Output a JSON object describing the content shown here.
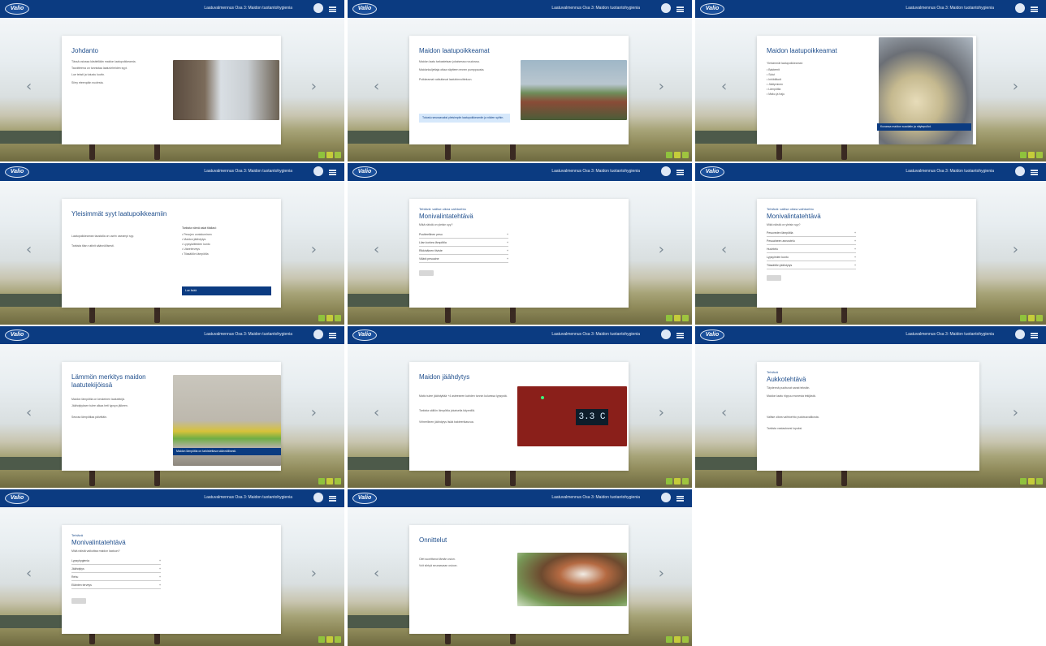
{
  "app": {
    "logo_text": "Valio",
    "course_title": "Laatuvalmennus Osa 3: Maidon tuotantohygienia",
    "prev_glyph": "‹",
    "next_glyph": "›",
    "colors": {
      "brand_blue": "#0b3b81",
      "title_blue": "#1f4e8c",
      "accent_green": "#8fc23d",
      "bubble_bg": "#d6e8fb"
    }
  },
  "slides": [
    {
      "title": "Johdanto",
      "lines": [
        "Tässä osiossa käsitellään maidon laatupoikkeamia.",
        "Tavoitteena on tunnistaa laatuvirheiden syyt.",
        "Lue teksti ja tutustu kuviin.",
        "Siirry eteenpäin nuolesta."
      ],
      "photo": "farmhouse-photo"
    },
    {
      "title": "Maidon laatupoikkeamat",
      "lines": [
        "Maidon laatu tarkastetaan jokaisessa noudossa.",
        "Maidonkuljettaja ottaa näytteen ennen pumppausta.",
        "Poikkeamat vaikuttavat laatuhinnoitteluun."
      ],
      "bubble": "Tutustu seuraavaksi yleisimpiin laatupoikkeamiin ja niiden syihin.",
      "photo": "milk-truck-photo"
    },
    {
      "title": "Maidon laatupoikkeamat",
      "lines": [
        "Yleisimmät laatupoikkeamat:",
        "• Bakteerit",
        "• Solut",
        "• Inhibiittorit",
        "• Jäätyminen",
        "• Lämpötila",
        "• Maku ja haju"
      ],
      "caption": "Kuvassa maidon suodatin ja näytepullot.",
      "photo": "milk-filter-photo"
    },
    {
      "title": "Yleisimmät syyt laatupoikkeamiin",
      "lines": [
        "Laatupoikkeaman taustalla on usein useampi syy.",
        "Tarkista tilan rutiinit säännöllisesti."
      ],
      "list_title": "Tarkista nämä asiat tilallasi:",
      "list": [
        "• Pesujen onnistuminen",
        "• Maidon jäähdytys",
        "• Lypsylaitteiden kunto",
        "• Utareterveys",
        "• Tilasäiliön lämpötila"
      ],
      "button": "Lue lisää"
    },
    {
      "sub": "Tehtävä: valitse oikea vaihtoehto",
      "title": "Monivalintatehtävä",
      "question": "Mikä näistä on yleisin syy?",
      "options": [
        "Puutteellinen pesu",
        "Liian korkea lämpötila",
        "Rikkinäinen tiiviste",
        "Väärä pesuaine"
      ]
    },
    {
      "sub": "Tehtävä: valitse oikea vaihtoehto",
      "title": "Monivalintatehtävä",
      "question": "Mikä näistä on yleisin syy?",
      "options": [
        "Pesuveden lämpötila",
        "Pesuaineen annostelu",
        "Huuhtelu",
        "Lypsyimien kunto",
        "Tilasäiliön jäähdytys"
      ]
    },
    {
      "title": "Lämmön merkitys maidon laatutekijöissä",
      "lines": [
        "Maidon lämpötila on keskeinen laatutekijä.",
        "Jäähdytyksen tulee alkaa heti lypsyn jälkeen.",
        "Seuraa lämpötilaa päivittäin."
      ],
      "caption": "Maidon lämpötila on tarkistettava säännöllisesti.",
      "photo": "test-strip-photo"
    },
    {
      "title": "Maidon jäähdytys",
      "lines": [
        "Maito tulee jäähdyttää +4 asteeseen kahden tunnin kuluessa lypsystä.",
        "Tarkista säiliön lämpötila jokaisella käynnillä.",
        "Virheellinen jäähdytys lisää bakteerikasvua."
      ],
      "display": "3.3 C",
      "photo": "cooling-panel-photo"
    },
    {
      "sub": "Tehtävä",
      "title": "Aukkotehtävä",
      "lines": [
        "Täydennä puuttuvat sanat tekstiin.",
        "Maidon laatu riippuu monesta tekijästä.",
        "Valitse oikea vaihtoehto pudotusvalikosta.",
        "Tarkista vastauksesi lopuksi."
      ]
    },
    {
      "sub": "Tehtävä",
      "title": "Monivalintatehtävä",
      "question": "Mikä näistä vaikuttaa maidon laatuun?",
      "options": [
        "Lypsyhygienia",
        "Jäähdytys",
        "Rehu",
        "Eläinten terveys"
      ]
    },
    {
      "title": "Onnittelut",
      "lines": [
        "Olet suorittanut tämän osion.",
        "Voit siirtyä seuraavaan osioon."
      ],
      "photo": "cows-photo"
    }
  ]
}
